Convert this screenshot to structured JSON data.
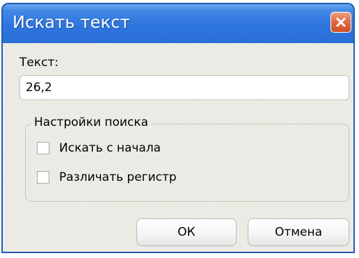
{
  "window": {
    "title": "Искать текст",
    "close_icon": "close-icon"
  },
  "search": {
    "label": "Текст:",
    "value": "26,2"
  },
  "options": {
    "legend": "Настройки поиска",
    "items": [
      {
        "label": "Искать с начала",
        "checked": false
      },
      {
        "label": "Различать регистр",
        "checked": false
      }
    ]
  },
  "buttons": {
    "ok_label": "ОК",
    "cancel_label": "Отмена"
  },
  "colors": {
    "titlebar": "#2e75de",
    "close": "#e06b45",
    "body": "#ecebe4"
  }
}
